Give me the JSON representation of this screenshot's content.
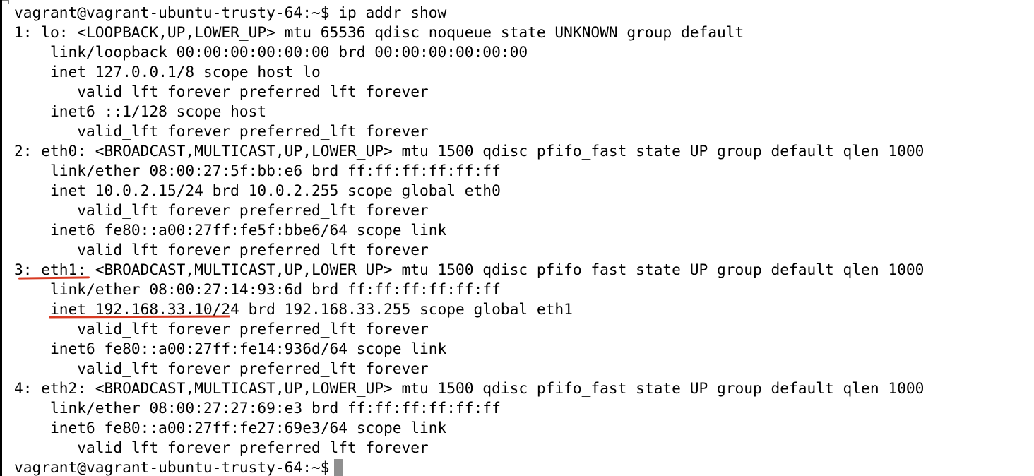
{
  "terminal": {
    "lines": [
      "vagrant@vagrant-ubuntu-trusty-64:~$ ip addr show",
      "1: lo: <LOOPBACK,UP,LOWER_UP> mtu 65536 qdisc noqueue state UNKNOWN group default",
      "    link/loopback 00:00:00:00:00:00 brd 00:00:00:00:00:00",
      "    inet 127.0.0.1/8 scope host lo",
      "       valid_lft forever preferred_lft forever",
      "    inet6 ::1/128 scope host",
      "       valid_lft forever preferred_lft forever",
      "2: eth0: <BROADCAST,MULTICAST,UP,LOWER_UP> mtu 1500 qdisc pfifo_fast state UP group default qlen 1000",
      "    link/ether 08:00:27:5f:bb:e6 brd ff:ff:ff:ff:ff:ff",
      "    inet 10.0.2.15/24 brd 10.0.2.255 scope global eth0",
      "       valid_lft forever preferred_lft forever",
      "    inet6 fe80::a00:27ff:fe5f:bbe6/64 scope link",
      "       valid_lft forever preferred_lft forever",
      "3: eth1: <BROADCAST,MULTICAST,UP,LOWER_UP> mtu 1500 qdisc pfifo_fast state UP group default qlen 1000",
      "    link/ether 08:00:27:14:93:6d brd ff:ff:ff:ff:ff:ff",
      "    inet 192.168.33.10/24 brd 192.168.33.255 scope global eth1",
      "       valid_lft forever preferred_lft forever",
      "    inet6 fe80::a00:27ff:fe14:936d/64 scope link",
      "       valid_lft forever preferred_lft forever",
      "4: eth2: <BROADCAST,MULTICAST,UP,LOWER_UP> mtu 1500 qdisc pfifo_fast state UP group default qlen 1000",
      "    link/ether 08:00:27:27:69:e3 brd ff:ff:ff:ff:ff:ff",
      "    inet6 fe80::a00:27ff:fe27:69e3/64 scope link",
      "       valid_lft forever preferred_lft forever"
    ],
    "prompt": "vagrant@vagrant-ubuntu-trusty-64:~$"
  },
  "annotations": {
    "color": "#d83a22",
    "marked_text": [
      "eth1",
      "inet 192.168.33.10"
    ]
  }
}
